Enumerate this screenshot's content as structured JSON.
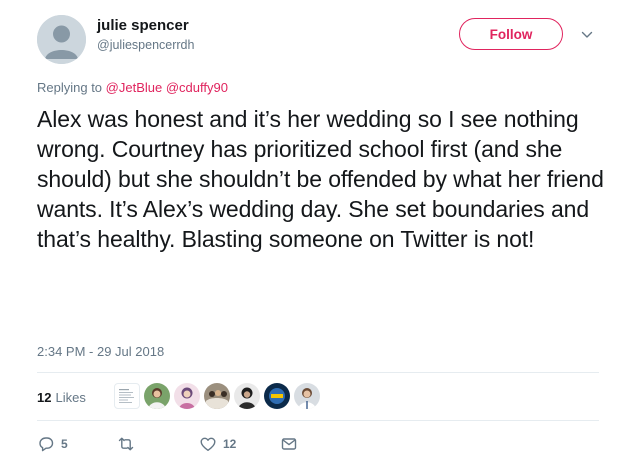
{
  "user": {
    "display_name": "julie spencer",
    "handle": "@juliespencerrdh"
  },
  "follow_label": "Follow",
  "replying": {
    "prefix": "Replying to",
    "mentions": [
      "@JetBlue",
      "@cduffy90"
    ]
  },
  "tweet": {
    "text": "Alex was honest and it’s her wedding so I see nothing wrong. Courtney has prioritized school first (and she should) but she shouldn’t be offended by what her friend wants. It’s Alex’s wedding day. She set boundaries and that’s healthy. Blasting someone on Twitter is not!",
    "timestamp": "2:34 PM - 29 Jul 2018"
  },
  "likes": {
    "count": "12",
    "label": "Likes"
  },
  "actions": {
    "reply_count": "5",
    "like_count": "12"
  },
  "colors": {
    "accent": "#e0245e",
    "secondary_text": "#657786",
    "divider": "#e6ecf0"
  },
  "icons": [
    "caret-down-icon",
    "reply-icon",
    "retweet-icon",
    "heart-icon",
    "message-icon"
  ]
}
